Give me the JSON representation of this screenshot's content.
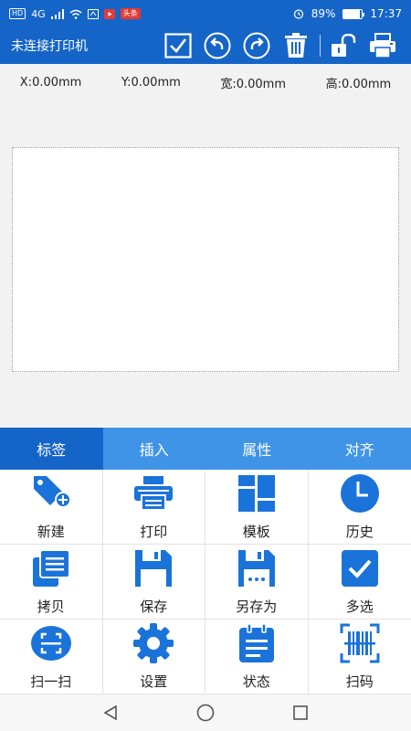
{
  "status": {
    "hd": "HD",
    "net": "4G",
    "battery": "89%",
    "battery_level": 0.89,
    "time": "17:37",
    "app_badge": "头条"
  },
  "toolbar": {
    "title": "未连接打印机"
  },
  "coords": {
    "x": "X:0.00mm",
    "y": "Y:0.00mm",
    "width": "宽:0.00mm",
    "height": "高:0.00mm"
  },
  "tabs": [
    {
      "label": "标签",
      "active": true
    },
    {
      "label": "插入",
      "active": false
    },
    {
      "label": "属性",
      "active": false
    },
    {
      "label": "对齐",
      "active": false
    }
  ],
  "grid": [
    {
      "label": "新建",
      "icon": "tag-plus-icon"
    },
    {
      "label": "打印",
      "icon": "printer-icon"
    },
    {
      "label": "模板",
      "icon": "template-icon"
    },
    {
      "label": "历史",
      "icon": "clock-icon"
    },
    {
      "label": "拷贝",
      "icon": "copy-icon"
    },
    {
      "label": "保存",
      "icon": "save-icon"
    },
    {
      "label": "另存为",
      "icon": "save-as-icon"
    },
    {
      "label": "多选",
      "icon": "checkbox-icon"
    },
    {
      "label": "扫一扫",
      "icon": "scan-icon"
    },
    {
      "label": "设置",
      "icon": "gear-icon"
    },
    {
      "label": "状态",
      "icon": "clipboard-icon"
    },
    {
      "label": "扫码",
      "icon": "barcode-scan-icon"
    }
  ],
  "colors": {
    "primary": "#1565c8",
    "tab_bg": "#3f94e8",
    "icon": "#1a73d9"
  }
}
